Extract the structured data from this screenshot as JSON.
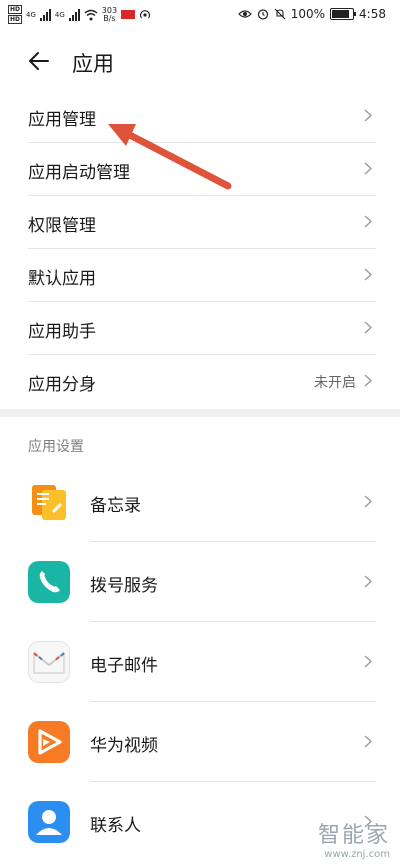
{
  "status_bar": {
    "net_speed_value": "303",
    "net_speed_unit": "B/s",
    "battery": "100%",
    "time": "4:58",
    "net_type_1": "4G",
    "net_type_2": "4G",
    "hd_1": "HD",
    "hd_2": "HD"
  },
  "header": {
    "title": "应用"
  },
  "settings_list": [
    {
      "label": "应用管理"
    },
    {
      "label": "应用启动管理"
    },
    {
      "label": "权限管理"
    },
    {
      "label": "默认应用"
    },
    {
      "label": "应用助手"
    },
    {
      "label": "应用分身",
      "status": "未开启"
    }
  ],
  "section": {
    "title": "应用设置"
  },
  "apps": [
    {
      "label": "备忘录",
      "icon": "memo-icon",
      "color": "#f39a1f"
    },
    {
      "label": "拨号服务",
      "icon": "phone-icon",
      "color": "#19b5a5"
    },
    {
      "label": "电子邮件",
      "icon": "email-icon",
      "color": "#f4f4f4"
    },
    {
      "label": "华为视频",
      "icon": "video-icon",
      "color": "#f77a24"
    },
    {
      "label": "联系人",
      "icon": "contacts-icon",
      "color": "#2a8ff0"
    }
  ],
  "annotation_color": "#e0533b",
  "watermark": {
    "brand": "智能家",
    "url": "www.znj.com"
  }
}
